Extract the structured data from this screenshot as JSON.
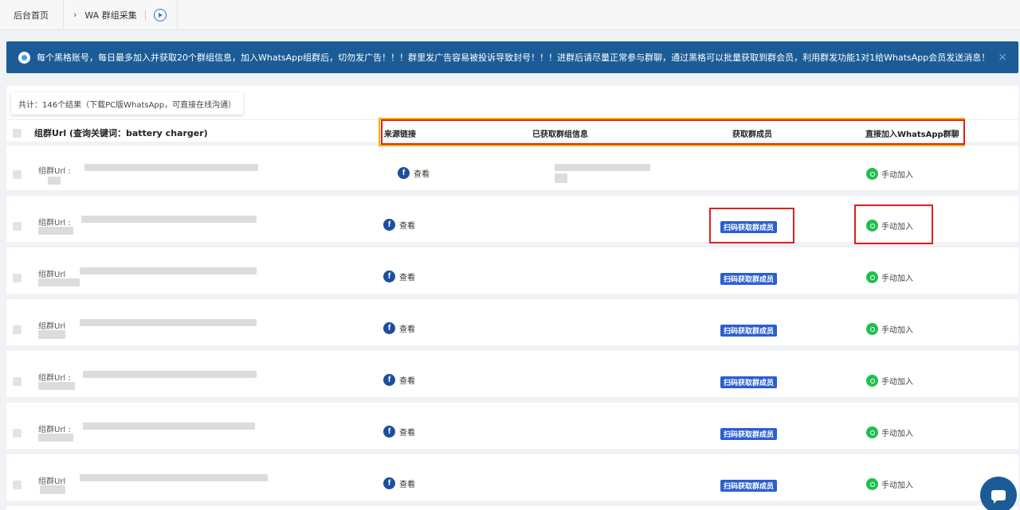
{
  "breadcrumb": {
    "home": "后台首页",
    "separator": "›",
    "current": "WA 群组采集"
  },
  "notice": {
    "text": "每个黑格账号，每日最多加入并获取20个群组信息，加入WhatsApp组群后，切勿发广告！！！群里发广告容易被投诉导致封号！！！进群后请尽量正常参与群聊，通过黑格可以批量获取到群会员，利用群发功能1对1给WhatsApp会员发送消息！",
    "close": "×"
  },
  "summary": {
    "count_text": "共计：146个结果（下载PC版WhatsApp，可直接在线沟通）"
  },
  "table": {
    "columns": {
      "main": "组群Url (查询关键词：battery charger)",
      "source": "来源链接",
      "fetched": "已获取群组信息",
      "members": "获取群成员",
      "join": "直接加入WhatsApp群聊"
    },
    "rows": [
      {
        "url_label": "组群Url :",
        "source": "查看",
        "member_button": "",
        "join": "手动加入"
      },
      {
        "url_label": "组群Url :",
        "source": "查看",
        "member_button": "扫码获取群成员",
        "join": "手动加入"
      },
      {
        "url_label": "组群Url",
        "source": "查看",
        "member_button": "扫码获取群成员",
        "join": "手动加入"
      },
      {
        "url_label": "组群Url",
        "source": "查看",
        "member_button": "扫码获取群成员",
        "join": "手动加入"
      },
      {
        "url_label": "组群Url :",
        "source": "查看",
        "member_button": "扫码获取群成员",
        "join": "手动加入"
      },
      {
        "url_label": "组群Url :",
        "source": "查看",
        "member_button": "扫码获取群成员",
        "join": "手动加入"
      },
      {
        "url_label": "组群Url",
        "source": "查看",
        "member_button": "扫码获取群成员",
        "join": "手动加入"
      }
    ]
  },
  "icons": {
    "play": "play-circle-icon",
    "info": "info-icon",
    "facebook": "facebook-icon",
    "whatsapp": "whatsapp-icon",
    "chat": "chat-bubble-icon"
  },
  "colors": {
    "notice_bg": "#1c5c96",
    "button_blue": "#2b5fcf",
    "highlight_red": "#e02020",
    "highlight_yellow": "#f5b400",
    "whatsapp_green": "#1fbf4d"
  }
}
